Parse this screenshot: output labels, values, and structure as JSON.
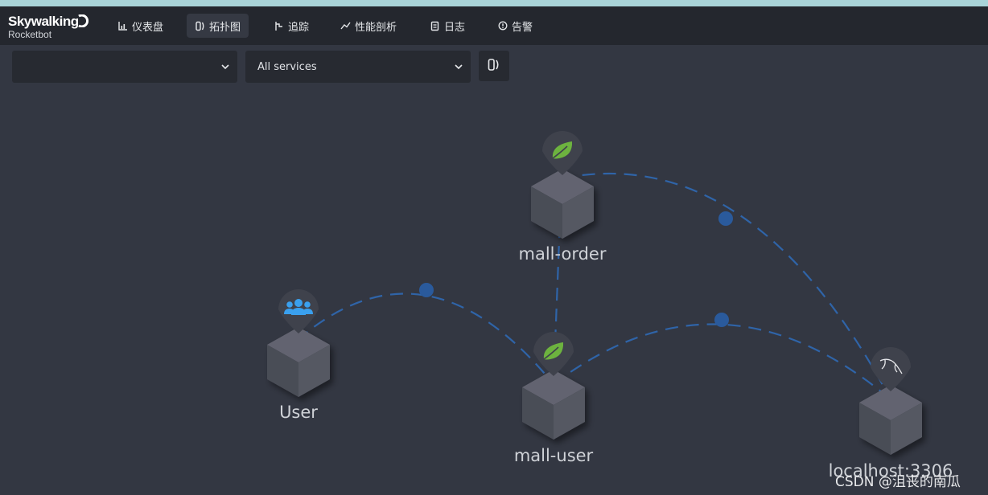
{
  "brand": {
    "name": "Skywalking",
    "subtitle": "Rocketbot"
  },
  "nav": [
    {
      "label": "仪表盘",
      "icon": "chart-icon",
      "active": false
    },
    {
      "label": "拓扑图",
      "icon": "topology-icon",
      "active": true
    },
    {
      "label": "追踪",
      "icon": "trace-icon",
      "active": false
    },
    {
      "label": "性能剖析",
      "icon": "profile-icon",
      "active": false
    },
    {
      "label": "日志",
      "icon": "log-icon",
      "active": false
    },
    {
      "label": "告警",
      "icon": "alarm-icon",
      "active": false
    }
  ],
  "toolbar": {
    "group_select_value": "",
    "service_select_value": "All services",
    "topology_button_icon": "topology-icon"
  },
  "topology": {
    "nodes": [
      {
        "id": "mall-order",
        "label": "mall-order",
        "type": "spring-icon"
      },
      {
        "id": "user",
        "label": "User",
        "type": "users-icon"
      },
      {
        "id": "mall-user",
        "label": "mall-user",
        "type": "spring-icon"
      },
      {
        "id": "localhost",
        "label": "localhost:3306",
        "type": "mysql-icon"
      }
    ],
    "edges": [
      {
        "from": "user",
        "to": "mall-user"
      },
      {
        "from": "mall-user",
        "to": "mall-order"
      },
      {
        "from": "mall-order",
        "to": "localhost"
      },
      {
        "from": "mall-user",
        "to": "localhost"
      }
    ]
  },
  "colors": {
    "background": "#333742",
    "navbar": "#24272e",
    "edge": "#2f64a8",
    "spring_green": "#6db33f",
    "users_blue": "#3aa0ee"
  },
  "watermark": "CSDN @沮丧的南瓜"
}
